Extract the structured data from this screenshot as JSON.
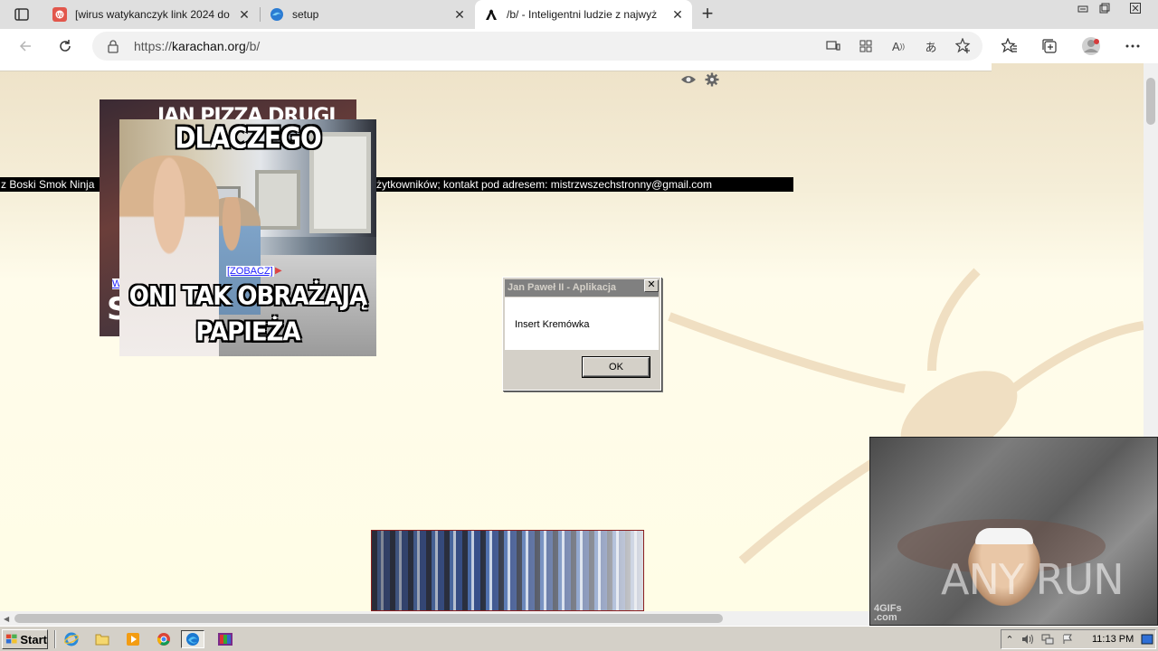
{
  "browser": {
    "tabs": [
      {
        "title": "[wirus watykanczyk link 2024 do",
        "close": "✕"
      },
      {
        "title": "setup",
        "close": "✕"
      },
      {
        "title": "/b/ - Inteligentni ludzie z najwyż",
        "close": "✕"
      }
    ],
    "new_tab": "+",
    "url_prefix": "https://",
    "url_domain": "karachan.org",
    "url_path": "/b/",
    "window_controls": [
      "minimize",
      "restore",
      "close"
    ]
  },
  "page": {
    "marquee_left": "z Boski Smok Ninja",
    "marquee_right": "żytkowników; kontakt pod adresem: mistrzwszechstronny@gmail.com",
    "meme_back_top": "JAN PIZZA DRUGI",
    "meme_back_letter": "S",
    "meme_back_link": "W",
    "meme_front_top": "DLACZEGO",
    "meme_front_bottom_1": "ONI TAK OBRAŻAJĄ",
    "meme_front_bottom_2": "PAPIEŻA",
    "zobacz_link": "[ZOBACZ]"
  },
  "dialog": {
    "title": "Jan Paweł II - Aplikacja",
    "message": "Insert Kremówka",
    "ok_label": "OK",
    "close": "✕"
  },
  "video_overlay": {
    "watermark": "ANY RUN",
    "source_line1": "4GIFs",
    "source_line2": ".com"
  },
  "taskbar": {
    "start_label": "Start",
    "clock": "11:13 PM"
  },
  "colors": {
    "tab_strip": "#dfdfdf",
    "page_bg": "#fffdf0",
    "marquee_bg": "#000000",
    "dialog_bg": "#d4d0c8",
    "taskbar_bg": "#d4d0c8"
  }
}
